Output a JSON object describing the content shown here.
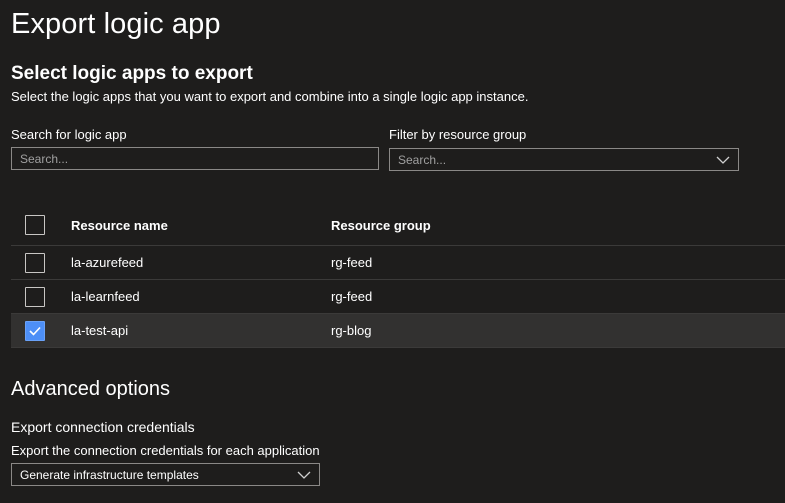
{
  "page": {
    "title": "Export logic app"
  },
  "select_section": {
    "title": "Select logic apps to export",
    "description": "Select the logic apps that you want to export and combine into a single logic app instance."
  },
  "search": {
    "label": "Search for logic app",
    "placeholder": "Search..."
  },
  "filter": {
    "label": "Filter by resource group",
    "placeholder": "Search..."
  },
  "table": {
    "columns": [
      "Resource name",
      "Resource group"
    ],
    "rows": [
      {
        "name": "la-azurefeed",
        "group": "rg-feed",
        "checked": false
      },
      {
        "name": "la-learnfeed",
        "group": "rg-feed",
        "checked": false
      },
      {
        "name": "la-test-api",
        "group": "rg-blog",
        "checked": true
      }
    ]
  },
  "advanced": {
    "title": "Advanced options",
    "credentials_title": "Export connection credentials",
    "credentials_desc": "Export the connection credentials for each application",
    "credentials_value": "Generate infrastructure templates"
  },
  "colors": {
    "background": "#1e1d1c",
    "checkbox_accent": "#4d8ff7",
    "selected_row": "#323130"
  }
}
